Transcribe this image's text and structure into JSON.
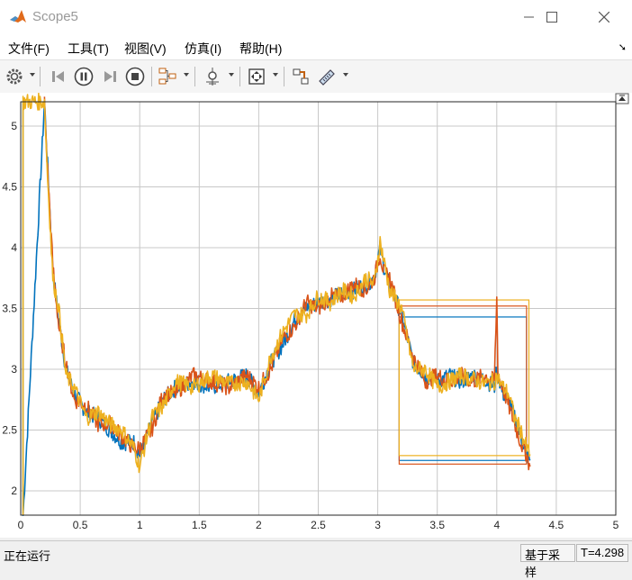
{
  "window": {
    "title": "Scope5"
  },
  "menu": [
    "文件(F)",
    "工具(T)",
    "视图(V)",
    "仿真(I)",
    "帮助(H)"
  ],
  "toolbar": {
    "icons": [
      "settings-icon",
      "step-back-icon",
      "pause-icon",
      "step-forward-icon",
      "stop-icon",
      "signal-select-icon",
      "trigger-icon",
      "zoom-fit-icon",
      "highlight-block-icon",
      "measurement-icon"
    ]
  },
  "status": {
    "left": "正在运行",
    "mode": "基于采样",
    "time": "T=4.298"
  },
  "colors": {
    "series1": "#0072bd",
    "series2": "#d95319",
    "series3": "#edb120",
    "grid": "#c8c8c8"
  },
  "chart_data": {
    "type": "line",
    "xlim": [
      0,
      5
    ],
    "ylim": [
      1.8,
      5.2
    ],
    "xticks": [
      "0",
      "0.5",
      "1",
      "1.5",
      "2",
      "2.5",
      "3",
      "3.5",
      "4",
      "4.5",
      "5"
    ],
    "xtick_values": [
      0,
      0.5,
      1,
      1.5,
      2,
      2.5,
      3,
      3.5,
      4,
      4.5,
      5
    ],
    "yticks": [
      "2",
      "2.5",
      "3",
      "3.5",
      "4",
      "4.5",
      "5"
    ],
    "ytick_values": [
      2,
      2.5,
      3,
      3.5,
      4,
      4.5,
      5
    ],
    "grid": true,
    "series": [
      {
        "values_x": [
          0.02,
          0.02,
          0.2,
          0.22,
          0.27,
          0.32,
          0.38,
          0.45,
          0.55,
          0.65,
          0.75,
          0.85,
          0.95,
          1.0,
          1.1,
          1.2,
          1.3,
          1.45,
          1.6,
          1.75,
          1.9,
          2.0,
          2.1,
          2.2,
          2.3,
          2.4,
          2.5,
          2.6,
          2.7,
          2.8,
          2.9,
          2.97,
          3.02,
          3.05,
          3.1,
          3.2,
          3.3,
          3.4,
          3.5,
          3.6,
          3.7,
          3.8,
          3.9,
          3.98,
          4.0,
          4.05,
          4.1,
          4.15,
          4.2,
          4.25,
          4.28
        ],
        "values_y": [
          5.2,
          1.8,
          5.2,
          4.8,
          3.8,
          3.4,
          3.0,
          2.8,
          2.65,
          2.6,
          2.5,
          2.4,
          2.4,
          2.3,
          2.55,
          2.75,
          2.85,
          2.9,
          2.85,
          2.9,
          2.95,
          2.8,
          3.05,
          3.2,
          3.4,
          3.5,
          3.55,
          3.58,
          3.62,
          3.65,
          3.7,
          3.75,
          4.0,
          3.85,
          3.7,
          3.45,
          3.05,
          2.95,
          2.9,
          2.95,
          2.9,
          2.95,
          2.92,
          2.85,
          3.0,
          2.8,
          2.75,
          2.6,
          2.45,
          2.3,
          2.25
        ]
      },
      {
        "values_x": [
          0.2,
          0.22,
          0.27,
          0.32,
          0.38,
          0.45,
          0.55,
          0.65,
          0.75,
          0.85,
          0.95,
          1.0,
          1.1,
          1.2,
          1.3,
          1.45,
          1.6,
          1.75,
          1.9,
          2.0,
          2.1,
          2.2,
          2.3,
          2.4,
          2.5,
          2.6,
          2.7,
          2.8,
          2.9,
          2.97,
          3.02,
          3.05,
          3.1,
          3.2,
          3.3,
          3.4,
          3.5,
          3.6,
          3.7,
          3.8,
          3.9,
          3.98,
          4.0,
          4.01,
          4.05,
          4.1,
          4.15,
          4.2,
          4.25,
          4.28
        ],
        "values_y": [
          5.2,
          4.75,
          3.85,
          3.35,
          3.05,
          2.75,
          2.7,
          2.55,
          2.55,
          2.45,
          2.35,
          2.35,
          2.5,
          2.8,
          2.8,
          2.95,
          2.9,
          2.85,
          2.95,
          2.85,
          3.0,
          3.25,
          3.35,
          3.55,
          3.5,
          3.6,
          3.6,
          3.7,
          3.65,
          3.75,
          3.95,
          3.8,
          3.75,
          3.4,
          3.1,
          2.9,
          2.95,
          2.9,
          2.95,
          2.9,
          2.95,
          2.9,
          3.58,
          2.95,
          2.85,
          2.7,
          2.55,
          2.4,
          2.3,
          2.2
        ]
      },
      {
        "values_x": [
          0.02,
          0.02,
          0.2,
          0.22,
          0.27,
          0.32,
          0.38,
          0.45,
          0.55,
          0.65,
          0.75,
          0.85,
          0.95,
          1.0,
          1.1,
          1.2,
          1.3,
          1.45,
          1.6,
          1.75,
          1.9,
          2.0,
          2.1,
          2.2,
          2.3,
          2.4,
          2.5,
          2.6,
          2.7,
          2.8,
          2.9,
          2.97,
          3.02,
          3.05,
          3.1,
          3.2,
          3.3,
          3.4,
          3.5,
          3.6,
          3.7,
          3.8,
          3.9,
          3.98,
          4.0,
          4.05,
          4.1,
          4.15,
          4.2,
          4.25,
          4.28
        ],
        "values_y": [
          1.8,
          5.2,
          5.2,
          4.7,
          3.75,
          3.5,
          2.95,
          2.85,
          2.6,
          2.65,
          2.55,
          2.5,
          2.35,
          2.2,
          2.6,
          2.7,
          2.9,
          2.85,
          2.95,
          2.88,
          2.9,
          2.75,
          3.1,
          3.3,
          3.45,
          3.45,
          3.6,
          3.55,
          3.65,
          3.6,
          3.75,
          3.7,
          4.05,
          3.9,
          3.65,
          3.5,
          3.0,
          3.0,
          2.85,
          2.9,
          2.95,
          2.92,
          2.88,
          2.9,
          2.95,
          2.85,
          2.8,
          2.6,
          2.5,
          2.35,
          2.3
        ]
      }
    ],
    "cursor_boxes": [
      {
        "color": "series1",
        "x0": 3.18,
        "x1": 4.25,
        "y_low": 2.25,
        "y_high": 3.43
      },
      {
        "color": "series2",
        "x0": 3.18,
        "x1": 4.25,
        "y_low": 2.22,
        "y_high": 3.52
      },
      {
        "color": "series3",
        "x0": 3.18,
        "x1": 4.27,
        "y_low": 2.29,
        "y_high": 3.57
      }
    ]
  }
}
